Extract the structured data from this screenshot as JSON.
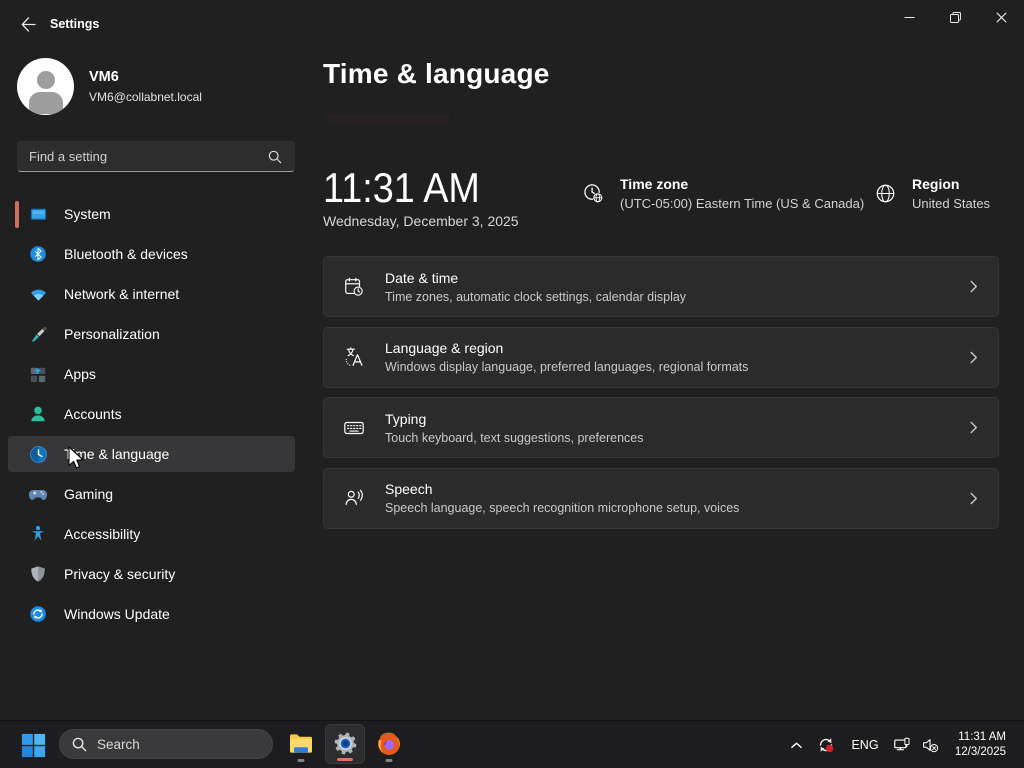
{
  "titlebar": {
    "app_title": "Settings"
  },
  "sidebar": {
    "user": {
      "name": "VM6",
      "email": "VM6@collabnet.local"
    },
    "search": {
      "placeholder": "Find a setting"
    },
    "items": [
      {
        "label": "System",
        "icon": "system-icon",
        "selected": false,
        "accent_pill": true
      },
      {
        "label": "Bluetooth & devices",
        "icon": "bluetooth-icon",
        "selected": false
      },
      {
        "label": "Network & internet",
        "icon": "network-icon",
        "selected": false
      },
      {
        "label": "Personalization",
        "icon": "personalization-icon",
        "selected": false
      },
      {
        "label": "Apps",
        "icon": "apps-icon",
        "selected": false
      },
      {
        "label": "Accounts",
        "icon": "accounts-icon",
        "selected": false
      },
      {
        "label": "Time & language",
        "icon": "time-language-icon",
        "selected": true
      },
      {
        "label": "Gaming",
        "icon": "gaming-icon",
        "selected": false
      },
      {
        "label": "Accessibility",
        "icon": "accessibility-icon",
        "selected": false
      },
      {
        "label": "Privacy & security",
        "icon": "privacy-icon",
        "selected": false
      },
      {
        "label": "Windows Update",
        "icon": "windows-update-icon",
        "selected": false
      }
    ]
  },
  "main": {
    "page_title": "Time & language",
    "clock": {
      "time": "11:31 AM",
      "date": "Wednesday, December 3, 2025"
    },
    "timezone": {
      "label": "Time zone",
      "value": "(UTC-05:00) Eastern Time (US & Canada)"
    },
    "region": {
      "label": "Region",
      "value": "United States"
    },
    "cards": [
      {
        "title": "Date & time",
        "subtitle": "Time zones, automatic clock settings, calendar display",
        "icon": "date-time-icon"
      },
      {
        "title": "Language & region",
        "subtitle": "Windows display language, preferred languages, regional formats",
        "icon": "language-region-icon"
      },
      {
        "title": "Typing",
        "subtitle": "Touch keyboard, text suggestions, preferences",
        "icon": "typing-icon"
      },
      {
        "title": "Speech",
        "subtitle": "Speech language, speech recognition microphone setup, voices",
        "icon": "speech-icon"
      }
    ]
  },
  "taskbar": {
    "search_placeholder": "Search",
    "apps": [
      {
        "name": "File Explorer",
        "running": true,
        "active": false
      },
      {
        "name": "Settings",
        "running": true,
        "active": true
      },
      {
        "name": "Firefox",
        "running": true,
        "active": false
      }
    ],
    "tray": {
      "language": "ENG",
      "time": "11:31 AM",
      "date": "12/3/2025"
    }
  },
  "colors": {
    "accent": "#e0735c",
    "background": "#202020",
    "card": "#2b2b2b",
    "taskbar": "#1d1d1f",
    "selected_nav": "#37373a"
  }
}
